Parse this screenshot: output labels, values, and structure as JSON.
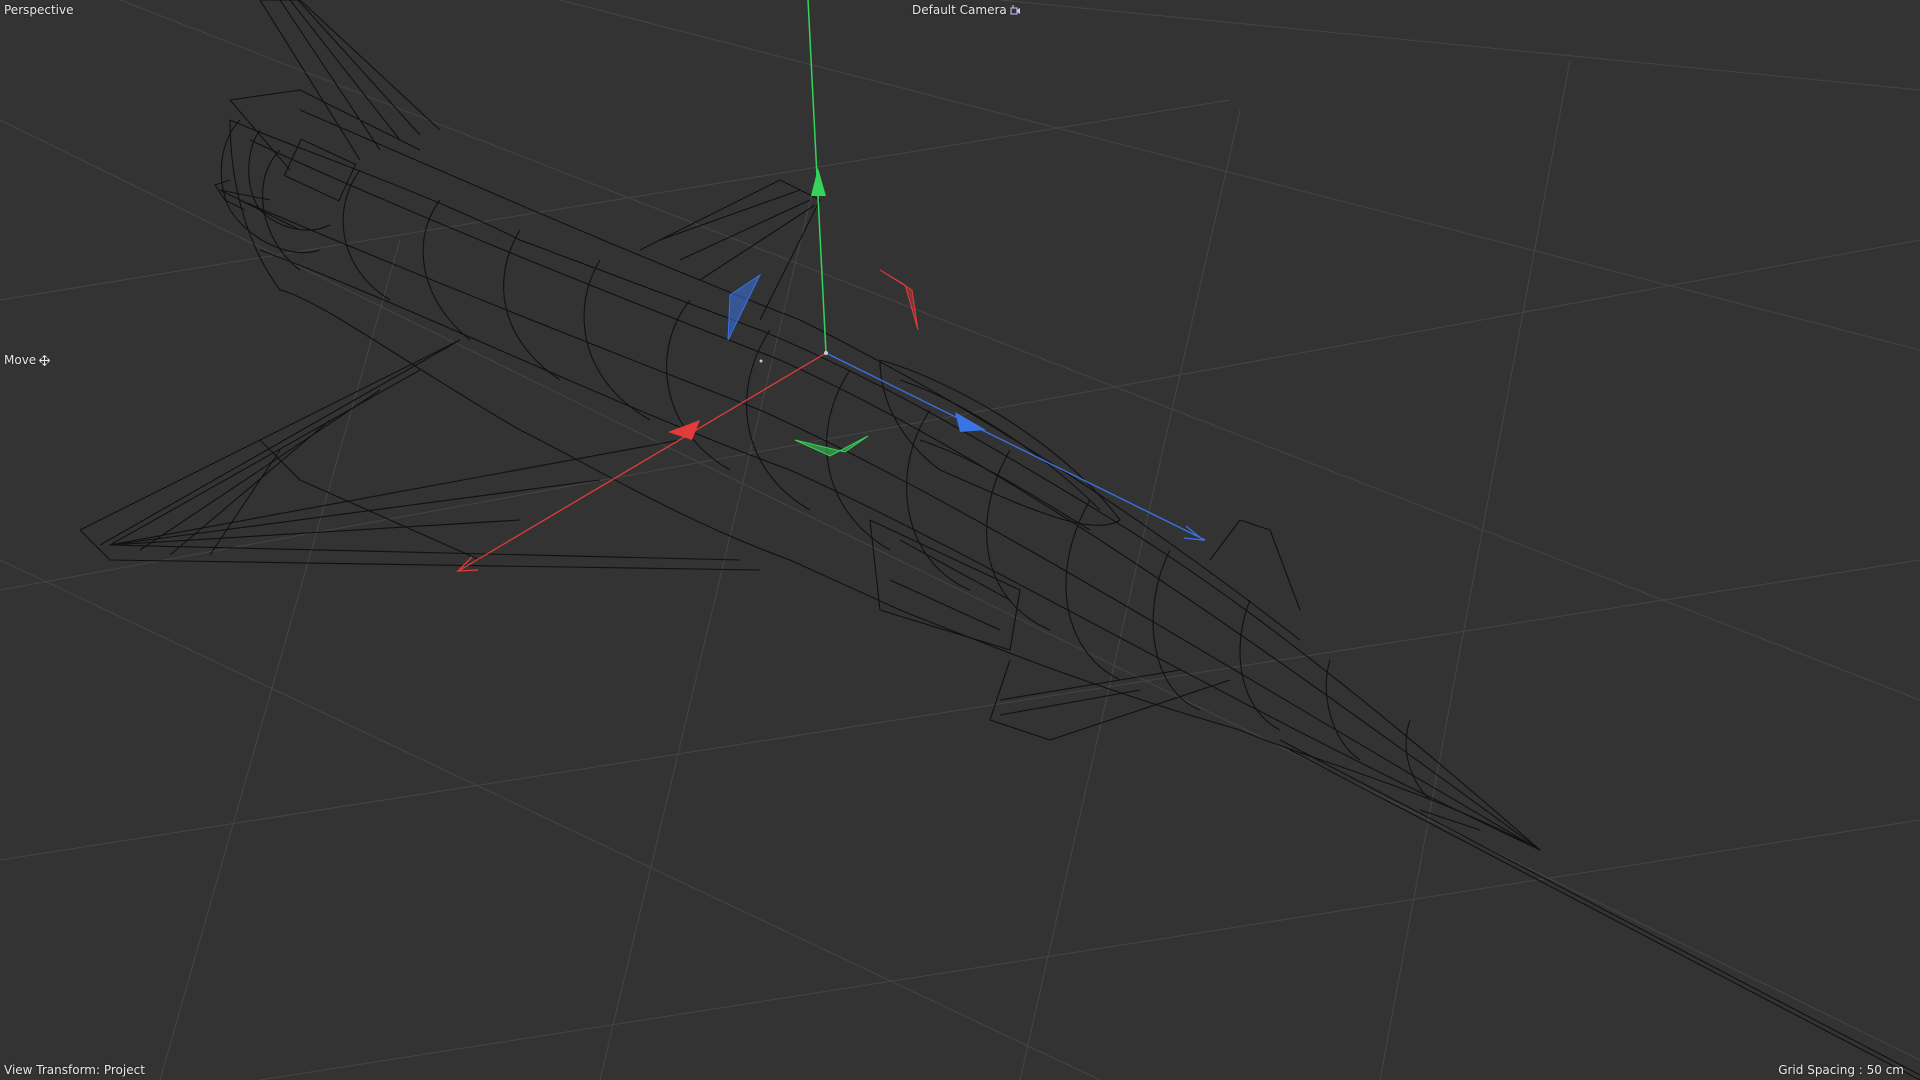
{
  "viewport": {
    "projection_label": "Perspective",
    "camera_label": "Default Camera",
    "camera_icon": "camera-icon",
    "tool_label": "Move",
    "tool_icon": "move-icon",
    "view_transform_label": "View Transform: Project",
    "grid_spacing_label": "Grid Spacing : 50 cm"
  },
  "colors": {
    "background": "#333333",
    "grid_line": "#454545",
    "wireframe": "#111111",
    "axis_x": "#e23b3b",
    "axis_y": "#35d35a",
    "axis_z": "#3a73e6",
    "hud_text": "#e6e6e6"
  }
}
